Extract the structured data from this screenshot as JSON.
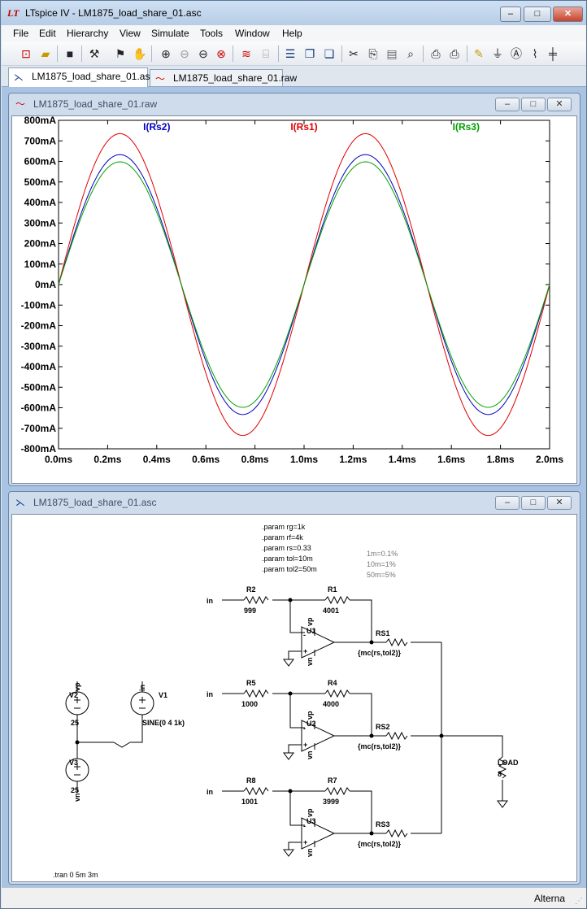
{
  "window": {
    "title": "LTspice IV - LM1875_load_share_01.asc",
    "app_icon_text": "LT",
    "minimize": "–",
    "maximize": "□",
    "close": "✕"
  },
  "menu": [
    "File",
    "Edit",
    "Hierarchy",
    "View",
    "Simulate",
    "Tools",
    "Window",
    "Help"
  ],
  "toolbar_icons": [
    "new-schematic-icon",
    "open-icon",
    "save-icon",
    "control-panel-icon",
    "run-icon",
    "halt-icon",
    "zoom-in-icon",
    "zoom-out-icon",
    "zoom-fit-icon",
    "cancel-zoom-icon",
    "waveform-icon",
    "autorange-icon",
    "tile-horizontal-icon",
    "cascade-icon",
    "tile-vertical-icon",
    "cut-icon",
    "copy-icon",
    "paste-icon",
    "find-icon",
    "print-preview-icon",
    "print-icon",
    "draw-wire-icon",
    "ground-icon",
    "label-net-icon",
    "resistor-icon",
    "capacitor-icon"
  ],
  "tabs": [
    {
      "label": "LM1875_load_share_01.asc",
      "icon": "schematic-icon",
      "active": true
    },
    {
      "label": "LM1875_load_share_01.raw",
      "icon": "waveform-icon",
      "active": false
    }
  ],
  "plot_window": {
    "title": "LM1875_load_share_01.raw",
    "minimize": "–",
    "maximize": "□",
    "close": "✕"
  },
  "schematic_window": {
    "title": "LM1875_load_share_01.asc",
    "minimize": "–",
    "maximize": "□",
    "close": "✕"
  },
  "chart_data": {
    "type": "line",
    "title": "",
    "xlabel": "",
    "ylabel": "",
    "x_unit": "ms",
    "y_unit": "mA",
    "xlim": [
      0,
      2.0
    ],
    "ylim": [
      -800,
      800
    ],
    "x_ticks": [
      "0.0ms",
      "0.2ms",
      "0.4ms",
      "0.6ms",
      "0.8ms",
      "1.0ms",
      "1.2ms",
      "1.4ms",
      "1.6ms",
      "1.8ms",
      "2.0ms"
    ],
    "y_ticks": [
      "800mA",
      "700mA",
      "600mA",
      "500mA",
      "400mA",
      "300mA",
      "200mA",
      "100mA",
      "0mA",
      "-100mA",
      "-200mA",
      "-300mA",
      "-400mA",
      "-500mA",
      "-600mA",
      "-700mA",
      "-800mA"
    ],
    "grid": false,
    "frequency_khz": 1,
    "series": [
      {
        "name": "I(Rs2)",
        "color": "#0000c0",
        "amplitude": 633
      },
      {
        "name": "I(Rs1)",
        "color": "#e00000",
        "amplitude": 735
      },
      {
        "name": "I(Rs3)",
        "color": "#00a000",
        "amplitude": 598
      }
    ]
  },
  "schematic": {
    "params": [
      ".param rg=1k",
      ".param rf=4k",
      ".param rs=0.33",
      ".param tol=10m",
      ".param tol2=50m"
    ],
    "notes": [
      "1m=0.1%",
      "10m=1%",
      "50m=5%"
    ],
    "tran": ".tran 0 5m 3m",
    "net_in": "in",
    "r2": {
      "name": "R2",
      "value": "999"
    },
    "r1": {
      "name": "R1",
      "value": "4001"
    },
    "r5": {
      "name": "R5",
      "value": "1000"
    },
    "r4": {
      "name": "R4",
      "value": "4000"
    },
    "r8": {
      "name": "R8",
      "value": "1001"
    },
    "r7": {
      "name": "R7",
      "value": "3999"
    },
    "u1": "U1",
    "u2": "U2",
    "u3": "U3",
    "rs1": {
      "name": "RS1",
      "value": "{mc(rs,tol2)}"
    },
    "rs2": {
      "name": "RS2",
      "value": "{mc(rs,tol2)}"
    },
    "rs3": {
      "name": "RS3",
      "value": "{mc(rs,tol2)}"
    },
    "load": {
      "name": "LOAD",
      "value": "8"
    },
    "v2": {
      "name": "V2",
      "value": "25"
    },
    "v3": {
      "name": "V3",
      "value": "25"
    },
    "v1": {
      "name": "V1",
      "value": "SINE(0 4 1k)"
    },
    "vp": "vp",
    "vn": "vn",
    "pin_plus": "+",
    "pin_minus": "-"
  },
  "status": {
    "text": "Alterna"
  }
}
